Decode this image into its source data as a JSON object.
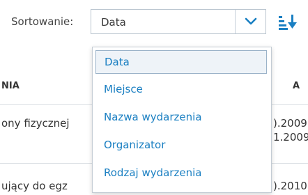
{
  "sort": {
    "label": "Sortowanie:",
    "selected_value": "Data",
    "direction_icon": "sort-descending-icon"
  },
  "dropdown": {
    "options": [
      {
        "label": "Data",
        "selected": true
      },
      {
        "label": "Miejsce",
        "selected": false
      },
      {
        "label": "Nazwa wydarzenia",
        "selected": false
      },
      {
        "label": "Organizator",
        "selected": false
      },
      {
        "label": "Rodzaj wydarzenia",
        "selected": false
      }
    ]
  },
  "table": {
    "header_left": "NIA",
    "header_right": "A",
    "rows": [
      {
        "name": "ony fizycznej",
        "date1": ").2009",
        "date2": "1.2009"
      },
      {
        "name": "ujący do egz",
        "date1": ").2010",
        "date2": ""
      }
    ]
  },
  "colors": {
    "accent": "#1a7fc2",
    "border": "#b9c4cf"
  }
}
